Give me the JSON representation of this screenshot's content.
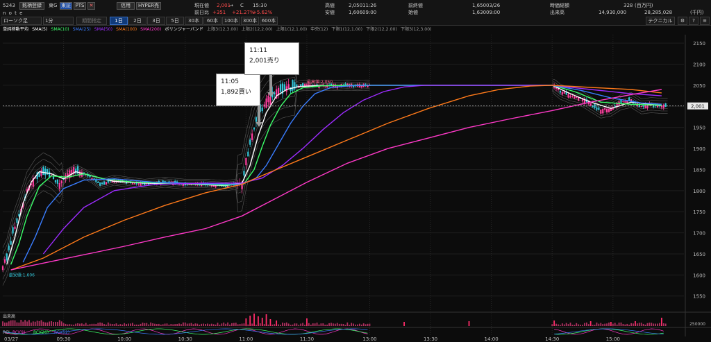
{
  "header": {
    "code": "5243",
    "tab_search": "銘柄登録",
    "market": "東G",
    "btn_tosho": "東証",
    "btn_pts": "PTS",
    "btn_shinyo": "信用",
    "btn_hyper": "HYPER売",
    "name": "n o t e",
    "row1_label1": "現在値",
    "row1_value1": "2,001",
    "row1_arrow": "→",
    "row1_mark": "C",
    "row1_time": "15:30",
    "row1_label2": "高値",
    "row1_value2": "2,050",
    "row1_time2": "11:26",
    "row1_label3": "前終値",
    "row1_value3": "1,650",
    "row1_date3": "03/26",
    "row1_label4": "時価総額",
    "row1_value4": "328",
    "row1_unit4": "(百万円)",
    "row2_label1": "前日比",
    "row2_value1": "+351",
    "row2_pct1": "+21.27%",
    "row2_pct2": "+5.62%",
    "row2_label2": "安値",
    "row2_value2": "1,606",
    "row2_time2": "09:00",
    "row2_label3": "始値",
    "row2_value3": "1,630",
    "row2_time3": "09:00",
    "row2_label4": "出来高",
    "row2_value4": "14,930,000",
    "row2_value5": "28,285,028",
    "row2_unit5": "(千円)",
    "chart_type_select": "ローソク足",
    "interval_select": "1分",
    "period_label": "期間指定",
    "period_tabs": [
      "1日",
      "2日",
      "3日",
      "5日",
      "30本",
      "60本",
      "100本",
      "300本",
      "600本"
    ],
    "technical_button": "テクニカル"
  },
  "legend": {
    "title": "単純移動平均",
    "items": [
      {
        "label": "SMA(5)",
        "color": "#ffffff"
      },
      {
        "label": "SMA(10)",
        "color": "#3cff6a"
      },
      {
        "label": "SMA(25)",
        "color": "#3a7dff"
      },
      {
        "label": "SMA(50)",
        "color": "#9d2cff"
      },
      {
        "label": "SMA(100)",
        "color": "#ff7a1a"
      },
      {
        "label": "SMA(200)",
        "color": "#ff39c8"
      },
      {
        "label": "ボリンジャーバンド",
        "color": "#ffffff"
      },
      {
        "label": "上限3(12,3.00)",
        "color": "#9a9a9a"
      },
      {
        "label": "上限2(12,2.00)",
        "color": "#9a9a9a"
      },
      {
        "label": "上限1(12,1.00)",
        "color": "#9a9a9a"
      },
      {
        "label": "中央(12)",
        "color": "#9a9a9a"
      },
      {
        "label": "下限1(12,1.00)",
        "color": "#9a9a9a"
      },
      {
        "label": "下限2(12,2.00)",
        "color": "#9a9a9a"
      },
      {
        "label": "下限3(12,3.00)",
        "color": "#9a9a9a"
      }
    ]
  },
  "annotations": {
    "buy_time": "11:05",
    "buy_text": "1,892買い",
    "sell_time": "11:11",
    "sell_text": "2,001売り",
    "high_label": "最高値:2,050",
    "low_label": "最安値:1,606",
    "current_price_label": "2,001"
  },
  "volume_panel": {
    "label": "出来高",
    "scale_label": "250000"
  },
  "rci_panel": {
    "label": "RCI",
    "items": [
      {
        "label": "RCI(9)",
        "color": "#ff39c8"
      },
      {
        "label": "RCI(26)",
        "color": "#3cff6a"
      },
      {
        "label": "RCI(52)",
        "color": "#3a7dff"
      }
    ]
  },
  "chart_data": {
    "type": "candlestick",
    "ylim": [
      1515,
      2170
    ],
    "y_ticks": [
      1550,
      1600,
      1650,
      1700,
      1750,
      1800,
      1850,
      1900,
      1950,
      2000,
      2050,
      2100,
      2150
    ],
    "x_ticks": [
      "03/27",
      "09:30",
      "10:00",
      "10:30",
      "11:00",
      "11:30",
      "13:00",
      "13:30",
      "14:00",
      "14:30",
      "15:00"
    ],
    "x_tick_minutes": [
      0,
      30,
      60,
      90,
      120,
      150,
      181,
      211,
      241,
      271,
      301
    ],
    "session_minutes": 336,
    "current_price": 2001,
    "high": 2050,
    "low": 1606,
    "price_path": [
      [
        0,
        1620
      ],
      [
        2,
        1640
      ],
      [
        5,
        1700
      ],
      [
        8,
        1740
      ],
      [
        12,
        1800
      ],
      [
        16,
        1830
      ],
      [
        20,
        1845
      ],
      [
        24,
        1835
      ],
      [
        28,
        1815
      ],
      [
        32,
        1840
      ],
      [
        36,
        1850
      ],
      [
        40,
        1840
      ],
      [
        44,
        1830
      ],
      [
        48,
        1815
      ],
      [
        55,
        1825
      ],
      [
        62,
        1820
      ],
      [
        70,
        1815
      ],
      [
        80,
        1820
      ],
      [
        90,
        1815
      ],
      [
        100,
        1815
      ],
      [
        110,
        1812
      ],
      [
        115,
        1815
      ],
      [
        118,
        1820
      ],
      [
        120,
        1870
      ],
      [
        123,
        1930
      ],
      [
        126,
        1980
      ],
      [
        130,
        2010
      ],
      [
        134,
        2030
      ],
      [
        138,
        2040
      ],
      [
        142,
        2045
      ],
      [
        146,
        2048
      ],
      [
        150,
        2050
      ],
      [
        155,
        2049
      ],
      [
        160,
        2050
      ],
      [
        165,
        2049
      ],
      [
        170,
        2050
      ],
      [
        175,
        2049
      ],
      [
        180,
        2050
      ],
      [
        271,
        2050
      ],
      [
        275,
        2035
      ],
      [
        280,
        2025
      ],
      [
        285,
        2020
      ],
      [
        290,
        2005
      ],
      [
        295,
        1990
      ],
      [
        300,
        1995
      ],
      [
        305,
        2010
      ],
      [
        310,
        2015
      ],
      [
        315,
        2000
      ],
      [
        320,
        2003
      ],
      [
        325,
        2001
      ]
    ],
    "series": [
      {
        "name": "SMA(5)",
        "color": "#ffffff",
        "points": [
          [
            2,
            1625
          ],
          [
            6,
            1690
          ],
          [
            10,
            1770
          ],
          [
            14,
            1820
          ],
          [
            18,
            1845
          ],
          [
            24,
            1840
          ],
          [
            30,
            1828
          ],
          [
            36,
            1845
          ],
          [
            44,
            1835
          ],
          [
            55,
            1822
          ],
          [
            70,
            1818
          ],
          [
            90,
            1816
          ],
          [
            110,
            1812
          ],
          [
            118,
            1818
          ],
          [
            122,
            1860
          ],
          [
            126,
            1930
          ],
          [
            130,
            1985
          ],
          [
            135,
            2025
          ],
          [
            140,
            2040
          ],
          [
            146,
            2047
          ],
          [
            155,
            2049
          ],
          [
            180,
            2050
          ],
          [
            271,
            2050
          ],
          [
            280,
            2030
          ],
          [
            290,
            2010
          ],
          [
            300,
            1995
          ],
          [
            310,
            2010
          ],
          [
            325,
            2002
          ]
        ]
      },
      {
        "name": "SMA(10)",
        "color": "#3cff6a",
        "points": [
          [
            4,
            1625
          ],
          [
            8,
            1675
          ],
          [
            12,
            1740
          ],
          [
            18,
            1810
          ],
          [
            24,
            1835
          ],
          [
            32,
            1832
          ],
          [
            40,
            1840
          ],
          [
            50,
            1828
          ],
          [
            65,
            1820
          ],
          [
            90,
            1817
          ],
          [
            110,
            1813
          ],
          [
            119,
            1816
          ],
          [
            124,
            1850
          ],
          [
            128,
            1905
          ],
          [
            132,
            1955
          ],
          [
            137,
            2000
          ],
          [
            142,
            2030
          ],
          [
            148,
            2044
          ],
          [
            158,
            2049
          ],
          [
            180,
            2050
          ],
          [
            271,
            2050
          ],
          [
            282,
            2035
          ],
          [
            295,
            2010
          ],
          [
            310,
            2005
          ],
          [
            325,
            2003
          ]
        ]
      },
      {
        "name": "SMA(25)",
        "color": "#3a7dff",
        "points": [
          [
            10,
            1630
          ],
          [
            16,
            1690
          ],
          [
            22,
            1760
          ],
          [
            30,
            1805
          ],
          [
            40,
            1825
          ],
          [
            55,
            1828
          ],
          [
            75,
            1820
          ],
          [
            100,
            1816
          ],
          [
            118,
            1815
          ],
          [
            125,
            1830
          ],
          [
            130,
            1860
          ],
          [
            136,
            1910
          ],
          [
            142,
            1960
          ],
          [
            148,
            2000
          ],
          [
            154,
            2030
          ],
          [
            162,
            2045
          ],
          [
            172,
            2049
          ],
          [
            180,
            2050
          ],
          [
            271,
            2050
          ],
          [
            285,
            2038
          ],
          [
            300,
            2020
          ],
          [
            315,
            2008
          ],
          [
            325,
            2005
          ]
        ]
      },
      {
        "name": "SMA(50)",
        "color": "#9d2cff",
        "points": [
          [
            20,
            1650
          ],
          [
            30,
            1710
          ],
          [
            40,
            1760
          ],
          [
            55,
            1800
          ],
          [
            75,
            1815
          ],
          [
            100,
            1818
          ],
          [
            118,
            1818
          ],
          [
            128,
            1830
          ],
          [
            138,
            1860
          ],
          [
            148,
            1900
          ],
          [
            158,
            1945
          ],
          [
            168,
            1985
          ],
          [
            178,
            2015
          ],
          [
            188,
            2035
          ],
          [
            198,
            2046
          ],
          [
            208,
            2050
          ],
          [
            271,
            2050
          ],
          [
            290,
            2040
          ],
          [
            310,
            2030
          ],
          [
            325,
            2025
          ]
        ]
      },
      {
        "name": "SMA(100)",
        "color": "#ff7a1a",
        "points": [
          [
            4,
            1612
          ],
          [
            20,
            1640
          ],
          [
            40,
            1690
          ],
          [
            60,
            1730
          ],
          [
            80,
            1765
          ],
          [
            100,
            1795
          ],
          [
            118,
            1815
          ],
          [
            130,
            1840
          ],
          [
            150,
            1880
          ],
          [
            170,
            1920
          ],
          [
            190,
            1960
          ],
          [
            210,
            1995
          ],
          [
            230,
            2025
          ],
          [
            245,
            2040
          ],
          [
            260,
            2048
          ],
          [
            271,
            2050
          ],
          [
            290,
            2045
          ],
          [
            310,
            2040
          ],
          [
            325,
            2032
          ]
        ]
      },
      {
        "name": "SMA(200)",
        "color": "#ff39c8",
        "points": [
          [
            4,
            1612
          ],
          [
            20,
            1628
          ],
          [
            40,
            1648
          ],
          [
            60,
            1668
          ],
          [
            80,
            1690
          ],
          [
            100,
            1710
          ],
          [
            118,
            1740
          ],
          [
            130,
            1770
          ],
          [
            150,
            1820
          ],
          [
            170,
            1865
          ],
          [
            190,
            1900
          ],
          [
            210,
            1925
          ],
          [
            230,
            1950
          ],
          [
            250,
            1970
          ],
          [
            271,
            1990
          ],
          [
            290,
            2010
          ],
          [
            310,
            2028
          ],
          [
            325,
            2040
          ]
        ]
      }
    ],
    "volume_spikes": [
      [
        120,
        0.55
      ],
      [
        122,
        0.75
      ],
      [
        124,
        0.9
      ],
      [
        126,
        0.7
      ],
      [
        128,
        0.6
      ],
      [
        130,
        0.85
      ],
      [
        132,
        0.5
      ],
      [
        135,
        0.4
      ],
      [
        150,
        0.55
      ],
      [
        198,
        0.3
      ],
      [
        230,
        0.35
      ],
      [
        272,
        0.4
      ],
      [
        290,
        0.35
      ],
      [
        300,
        0.3
      ],
      [
        312,
        0.35
      ],
      [
        325,
        0.6
      ]
    ]
  }
}
